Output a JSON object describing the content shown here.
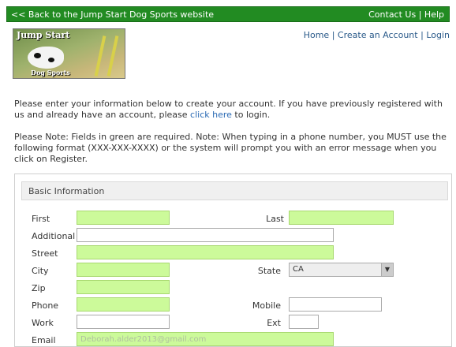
{
  "topbar": {
    "back_link": "<< Back to the Jump Start Dog Sports website",
    "contact_us": "Contact Us",
    "separator": "|",
    "help": "Help"
  },
  "logo": {
    "top_text": "Jump Start",
    "bottom_text": "Dog Sports"
  },
  "nav": {
    "home": "Home",
    "create_account": "Create an Account",
    "login": "Login",
    "separator": "|"
  },
  "intro": {
    "text_before": "Please enter your information below to create your account. If you have previously registered with us and already have an account, please ",
    "link": "click here",
    "text_after": " to login."
  },
  "note": {
    "text": "Please Note: Fields in green are required. Note: When typing in a phone number, you MUST use the following format (XXX-XXX-XXXX) or the system will prompt you with an error message when you click on Register."
  },
  "form": {
    "section_title": "Basic Information",
    "labels": {
      "first": "First",
      "last": "Last",
      "additional": "Additional",
      "street": "Street",
      "city": "City",
      "state": "State",
      "zip": "Zip",
      "phone": "Phone",
      "mobile": "Mobile",
      "work": "Work",
      "ext": "Ext",
      "email": "Email"
    },
    "values": {
      "state": "CA",
      "email": "Deborah.alder2013@gmail.com"
    },
    "colors": {
      "required_bg": "#ccfa9a",
      "topbar_bg": "#228b22"
    }
  }
}
